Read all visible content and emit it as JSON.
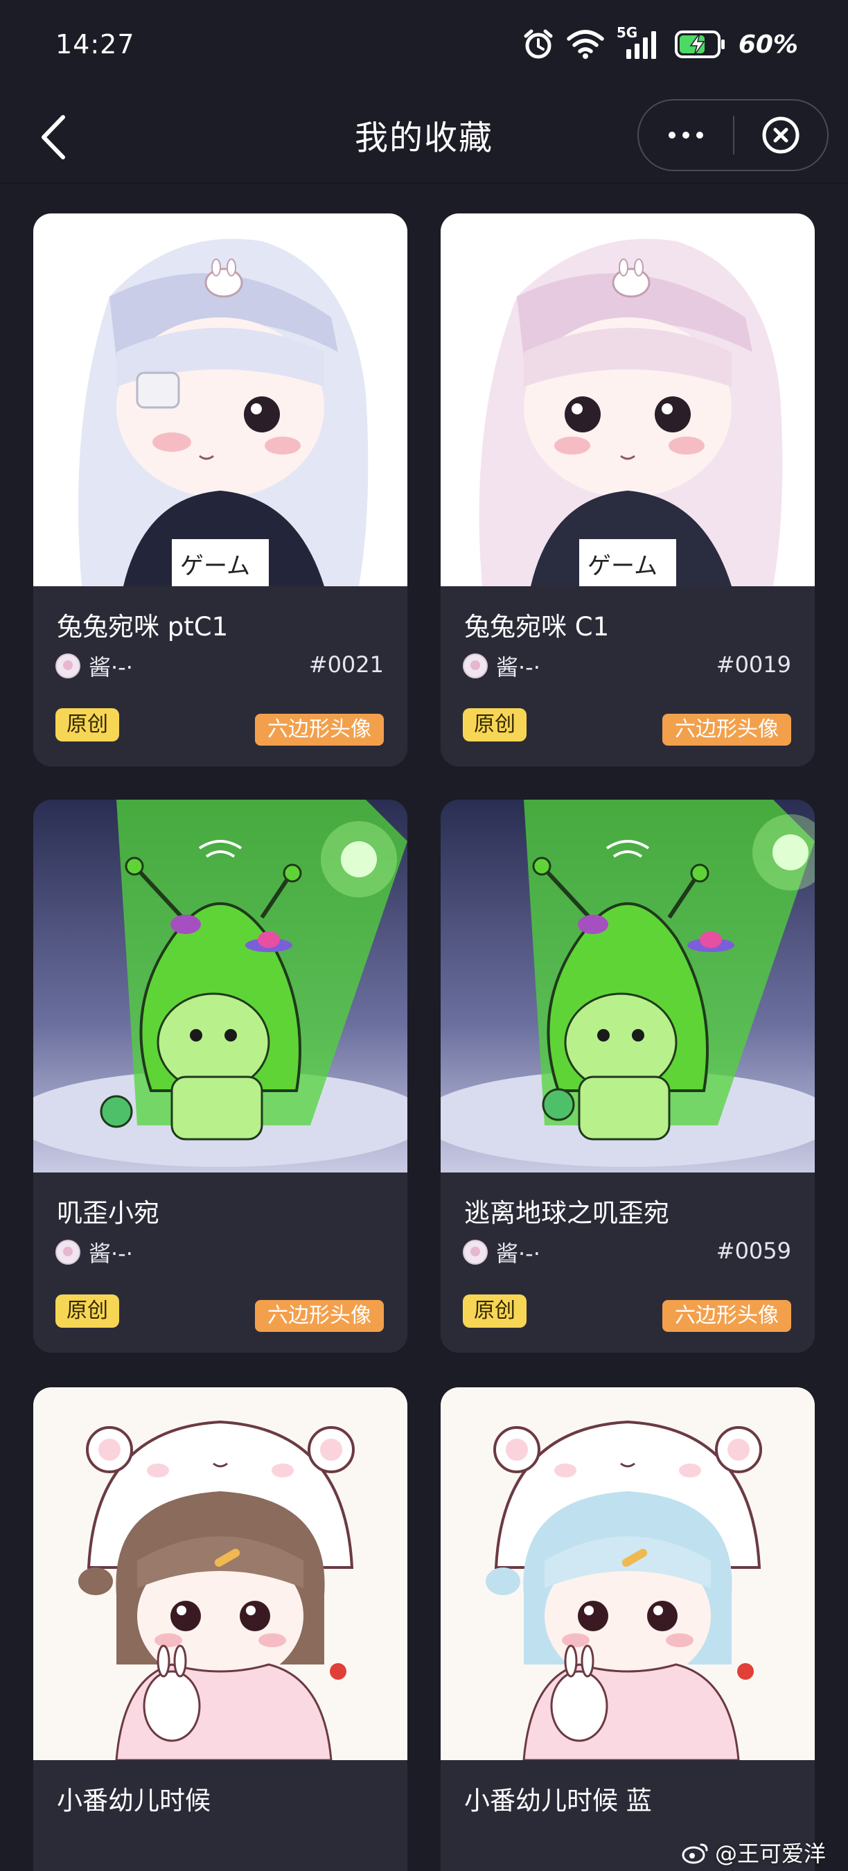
{
  "status_bar": {
    "time": "14:27",
    "network": "5G",
    "battery": "60%",
    "icons": [
      "alarm-icon",
      "wifi-icon",
      "signal-icon",
      "battery-charging-icon"
    ]
  },
  "nav": {
    "title": "我的收藏",
    "back_icon": "chevron-left-icon",
    "more_icon": "more-dots-icon",
    "close_icon": "close-circle-icon"
  },
  "cards": [
    {
      "title": "兔兔宛咪 ptC1",
      "author": "酱·-·",
      "number": "#0021",
      "badge": "原创",
      "tag": "六边形头像",
      "art": "white-hair-girl"
    },
    {
      "title": "兔兔宛咪 C1",
      "author": "酱·-·",
      "number": "#0019",
      "badge": "原创",
      "tag": "六边形头像",
      "art": "pink-hair-girl"
    },
    {
      "title": "叽歪小宛",
      "author": "酱·-·",
      "number": "",
      "badge": "原创",
      "tag": "六边形头像",
      "art": "green-alien"
    },
    {
      "title": "逃离地球之叽歪宛",
      "author": "酱·-·",
      "number": "#0059",
      "badge": "原创",
      "tag": "六边形头像",
      "art": "green-alien"
    },
    {
      "title": "小番幼儿时候",
      "author": "",
      "number": "",
      "badge": "",
      "tag": "",
      "art": "brown-hair-bear-hood"
    },
    {
      "title": "小番幼儿时候 蓝",
      "author": "",
      "number": "",
      "badge": "",
      "tag": "",
      "art": "blue-hair-bear-hood"
    }
  ],
  "watermark": {
    "text": "@王可爱洋",
    "icon": "weibo-icon"
  },
  "colors": {
    "background": "#1c1c26",
    "card": "#2b2b38",
    "badge_yellow": "#f7d655",
    "badge_orange": "#f3a04c"
  }
}
